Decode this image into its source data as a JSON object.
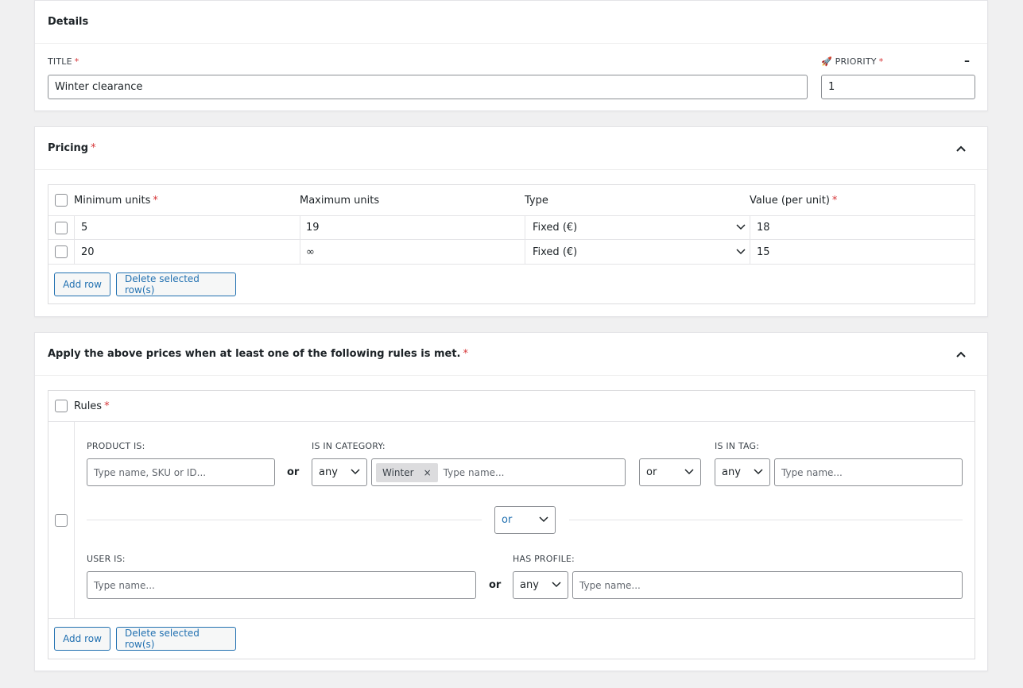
{
  "details": {
    "heading": "Details",
    "title_label": "TITLE",
    "title_value": "Winter clearance",
    "priority_label": "PRIORITY",
    "priority_icon": "🚀",
    "priority_value": "1",
    "required": "*",
    "collapse_symbol": "–"
  },
  "pricing": {
    "heading": "Pricing",
    "required": "*",
    "columns": [
      "Minimum units",
      "Maximum units",
      "Type",
      "Value (per unit)"
    ],
    "rows": [
      {
        "min": "5",
        "max": "19",
        "type": "Fixed (€)",
        "value": "18"
      },
      {
        "min": "20",
        "max": "∞",
        "type": "Fixed (€)",
        "value": "15"
      }
    ],
    "add_row": "Add row",
    "delete_rows": "Delete selected row(s)"
  },
  "rules": {
    "heading": "Apply the above prices when at least one of the following rules is met.",
    "required": "*",
    "column_label": "Rules",
    "product_label": "PRODUCT IS:",
    "product_placeholder": "Type name, SKU or ID...",
    "or": "or",
    "category_label": "IS IN CATEGORY:",
    "category_any": "any",
    "category_tag": "Winter",
    "category_tag_remove": "×",
    "category_placeholder": "Type name...",
    "tag_or": "or",
    "tag_label": "IS IN TAG:",
    "tag_any": "any",
    "tag_placeholder": "Type name...",
    "group_or": "or",
    "user_label": "USER IS:",
    "user_placeholder": "Type name...",
    "profile_label": "HAS PROFILE:",
    "profile_any": "any",
    "profile_placeholder": "Type name...",
    "add_row": "Add row",
    "delete_rows": "Delete selected row(s)"
  },
  "colors": {
    "accent": "#2271b1",
    "required": "#d63638"
  }
}
